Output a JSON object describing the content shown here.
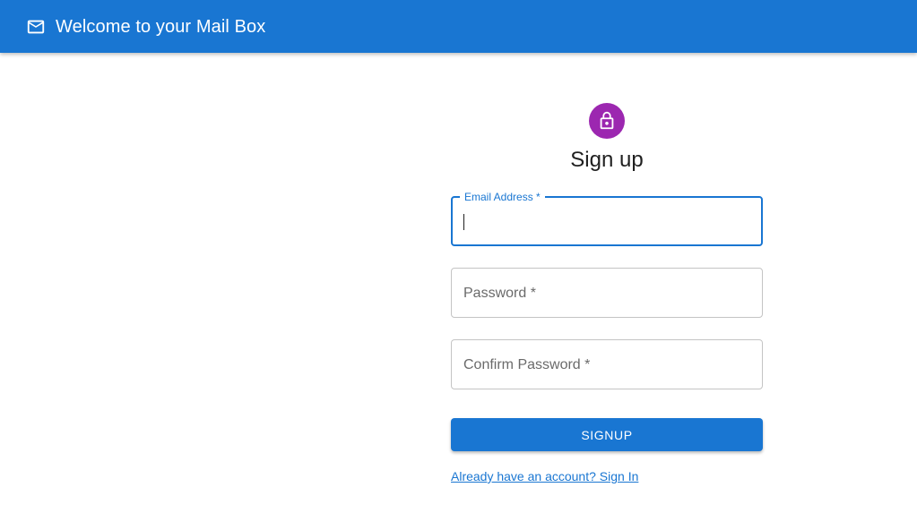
{
  "appbar": {
    "title": "Welcome to your Mail Box",
    "icon": "mail-icon"
  },
  "form": {
    "avatar_icon": "lock-icon",
    "heading": "Sign up",
    "fields": [
      {
        "label": "Email Address *",
        "value": "",
        "state": "focused"
      },
      {
        "label": "Password *",
        "value": ""
      },
      {
        "label": "Confirm Password *",
        "value": ""
      }
    ],
    "submit_label": "SIGNUP",
    "signin_link": "Already have an account? Sign In"
  },
  "colors": {
    "primary": "#1976d2",
    "avatar": "#9c27b0",
    "border": "#c4c4c4"
  }
}
